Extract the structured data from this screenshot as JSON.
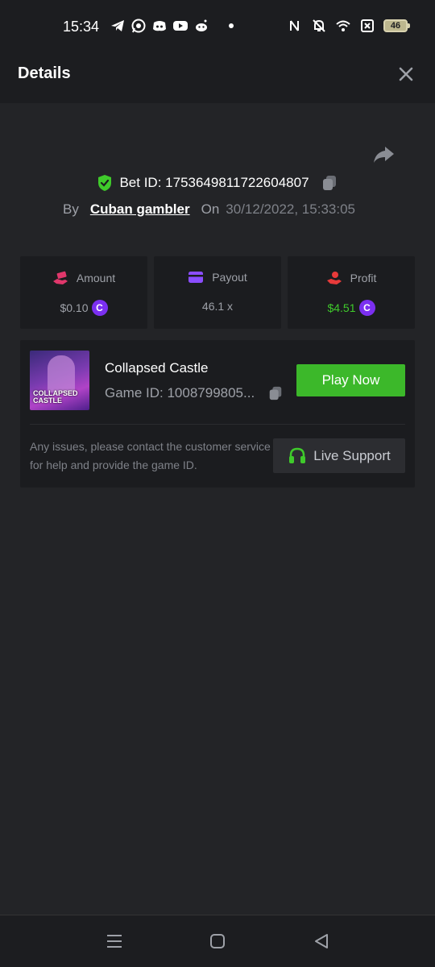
{
  "status_bar": {
    "time": "15:34",
    "battery": "46",
    "icons_left": [
      "telegram-icon",
      "whatsapp-icon",
      "discord-icon",
      "youtube-icon",
      "reddit-icon",
      "dot-icon"
    ],
    "icons_right": [
      "nfc-icon",
      "bell-off-icon",
      "wifi-icon",
      "sim-icon",
      "battery-icon"
    ]
  },
  "header": {
    "title": "Details"
  },
  "bet": {
    "id_text": "Bet ID: 1753649811722604807",
    "by_label": "By",
    "user": "Cuban gambler",
    "on_label": "On",
    "date": "30/12/2022, 15:33:05"
  },
  "stats": {
    "amount_label": "Amount",
    "amount_value": "$0.10",
    "payout_label": "Payout",
    "payout_value": "46.1 x",
    "profit_label": "Profit",
    "profit_value": "$4.51",
    "coin_symbol": "C"
  },
  "game": {
    "thumb_text_1": "COLLAPSED",
    "thumb_text_2": "CASTLE",
    "name": "Collapsed Castle",
    "id_text": "Game ID: 1008799805...",
    "play_label": "Play Now",
    "help_text": "Any issues, please contact the customer service for help and provide the game ID.",
    "support_label": "Live Support"
  },
  "colors": {
    "accent_green": "#3cb82a",
    "profit_green": "#3fca2b",
    "coin_purple": "#7b2ff0",
    "background": "#232427"
  }
}
